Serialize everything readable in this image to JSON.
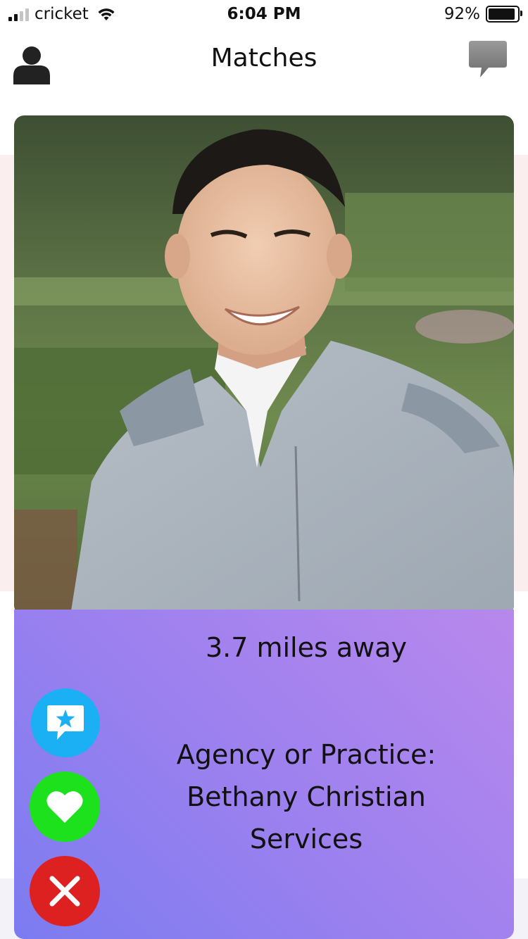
{
  "status_bar": {
    "carrier": "cricket",
    "time": "6:04 PM",
    "battery_text": "92%",
    "battery_level": 0.92,
    "signal_bars": 2,
    "signal_max": 4
  },
  "nav": {
    "title": "Matches",
    "left_icon": "profile-icon",
    "right_icon": "chat-bubble-icon"
  },
  "card": {
    "photo_icon": "profile-photo",
    "distance": "3.7 miles away",
    "agency_lines": [
      "Agency or Practice:",
      "Bethany Christian",
      "Services"
    ]
  },
  "actions": {
    "superlike_icon": "star-message-icon",
    "like_icon": "heart-icon",
    "pass_icon": "close-icon"
  },
  "colors": {
    "superlike": "#1ab0f3",
    "like": "#1ce11c",
    "pass": "#dd2121",
    "gradient_start": "#7b7cf0",
    "gradient_end": "#b888ec"
  }
}
